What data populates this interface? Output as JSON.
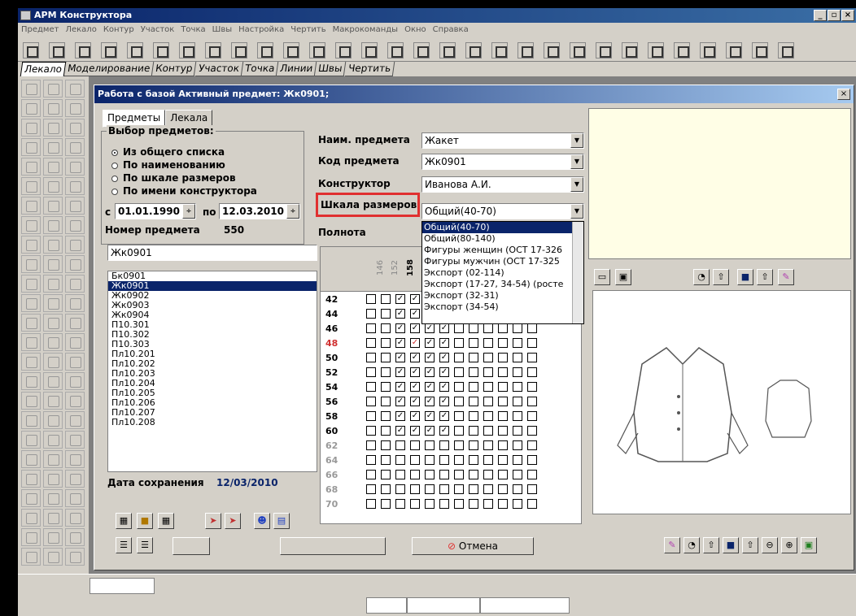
{
  "app": {
    "title": "АРМ Конструктора"
  },
  "menu": [
    "Предмет",
    "Лекало",
    "Контур",
    "Участок",
    "Точка",
    "Швы",
    "Настройка",
    "Чертить",
    "Макрокоманды",
    "Окно",
    "Справка"
  ],
  "tabs": [
    "Лекало",
    "Моделирование",
    "Контур",
    "Участок",
    "Точка",
    "Линии",
    "Швы",
    "Чертить"
  ],
  "dialog": {
    "title": "Работа с базой Активный предмет: Жк0901;",
    "subtabs": [
      "Предметы",
      "Лекала"
    ],
    "selection": {
      "group_label": "Выбор предметов:",
      "options": [
        "Из общего списка",
        "По наименованию",
        "По шкале размеров",
        "По имени конструктора"
      ],
      "selected_index": 0
    },
    "date_from_label": "с",
    "date_from": "01.01.1990",
    "date_to_label": "по",
    "date_to": "12.03.2010",
    "item_number_label": "Номер предмета",
    "item_number": "550",
    "search_value": "Жк0901",
    "items": [
      "Бк0901",
      "Жк0901",
      "Жк0902",
      "Жк0903",
      "Жк0904",
      "П10.301",
      "П10.302",
      "П10.303",
      "Пл10.201",
      "Пл10.202",
      "Пл10.203",
      "Пл10.204",
      "Пл10.205",
      "Пл10.206",
      "Пл10.207",
      "Пл10.208"
    ],
    "selected_item_index": 1,
    "save_date_label": "Дата сохранения",
    "save_date": "12/03/2010",
    "name_label": "Наим. предмета",
    "name_value": "Жакет",
    "code_label": "Код предмета",
    "code_value": "Жк0901",
    "designer_label": "Конструктор",
    "designer_value": "Иванова А.И.",
    "scale_label": "Шкала размеров",
    "scale_value": "Общий(40-70)",
    "fullness_label": "Полнота",
    "scale_options": [
      "Общий(40-70)",
      "Общий(80-140)",
      "Фигуры женщин (ОСТ 17-326",
      "Фигуры мужчин (ОСТ 17-325",
      "Экспорт (02-114)",
      "Экспорт (17-27, 34-54) (росте",
      "Экспорт (32-31)",
      "Экспорт (34-54)"
    ],
    "scale_selected_index": 0,
    "grid_columns": [
      "146",
      "152",
      "158",
      "164"
    ],
    "grid_rows": [
      "42",
      "44",
      "46",
      "48",
      "50",
      "52",
      "54",
      "56",
      "58",
      "60",
      "62",
      "64",
      "66",
      "68",
      "70"
    ],
    "cancel_label": "Отмена"
  }
}
